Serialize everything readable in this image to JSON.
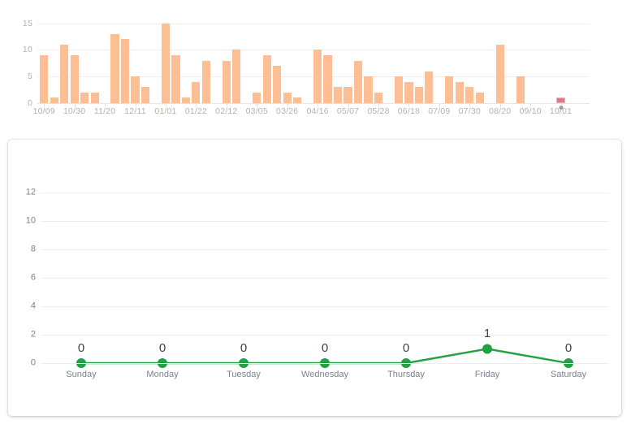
{
  "bar_chart": {
    "y_ticks": [
      0,
      5,
      10,
      15
    ],
    "y_max": 16,
    "x_labels": [
      "10/09",
      "10/30",
      "11/20",
      "12/11",
      "01/01",
      "01/22",
      "02/12",
      "03/05",
      "03/26",
      "04/16",
      "05/07",
      "05/28",
      "06/18",
      "07/09",
      "07/30",
      "08/20",
      "09/10",
      "10/01"
    ],
    "bar_color": "#fcbe92",
    "highlight_color": "#d9798b",
    "marker_color": "#9e9e9e"
  },
  "line_chart": {
    "y_ticks": [
      0,
      2,
      4,
      6,
      8,
      10,
      12
    ],
    "y_max": 13,
    "line_color": "#22a043",
    "point_labels": [
      "0",
      "0",
      "0",
      "0",
      "0",
      "1",
      "0"
    ]
  },
  "chart_data": [
    {
      "type": "bar",
      "title": "",
      "xlabel": "",
      "ylabel": "",
      "ylim": [
        0,
        16
      ],
      "grid": true,
      "legend": "none",
      "categories": [
        "10/09",
        "10/16",
        "10/23",
        "10/30",
        "11/06",
        "11/13",
        "11/20",
        "11/27",
        "12/04",
        "12/11",
        "12/18",
        "12/25",
        "01/01",
        "01/08",
        "01/15",
        "01/22",
        "01/29",
        "02/05",
        "02/12",
        "02/19",
        "02/26",
        "03/05",
        "03/12",
        "03/19",
        "03/26",
        "04/02",
        "04/09",
        "04/16",
        "04/23",
        "04/30",
        "05/07",
        "05/14",
        "05/21",
        "05/28",
        "06/04",
        "06/11",
        "06/18",
        "06/25",
        "07/02",
        "07/09",
        "07/16",
        "07/23",
        "07/30",
        "08/06",
        "08/13",
        "08/20",
        "08/27",
        "09/03",
        "09/10",
        "09/17",
        "09/24",
        "10/01"
      ],
      "values": [
        9,
        1,
        11,
        9,
        2,
        2,
        0,
        13,
        12,
        5,
        3,
        0,
        15,
        9,
        1,
        4,
        8,
        0,
        8,
        10,
        0,
        2,
        9,
        7,
        2,
        1,
        0,
        10,
        9,
        3,
        3,
        8,
        5,
        2,
        0,
        5,
        4,
        3,
        6,
        0,
        5,
        4,
        3,
        2,
        0,
        11,
        0,
        5,
        0,
        0,
        0,
        1
      ],
      "tick_label_every": 3,
      "tick_labels": [
        "10/09",
        "10/30",
        "11/20",
        "12/11",
        "01/01",
        "01/22",
        "02/12",
        "03/05",
        "03/26",
        "04/16",
        "05/07",
        "05/28",
        "06/18",
        "07/09",
        "07/30",
        "08/20",
        "09/10",
        "10/01"
      ],
      "highlight_index": 51,
      "colors": {
        "bars": "#fcbe92",
        "highlight": "#d9798b"
      }
    },
    {
      "type": "line",
      "title": "",
      "xlabel": "",
      "ylabel": "",
      "ylim": [
        0,
        13
      ],
      "grid": true,
      "legend": "none",
      "categories": [
        "Sunday",
        "Monday",
        "Tuesday",
        "Wednesday",
        "Thursday",
        "Friday",
        "Saturday"
      ],
      "values": [
        0,
        0,
        0,
        0,
        0,
        1,
        0
      ],
      "data_labels": [
        "0",
        "0",
        "0",
        "0",
        "0",
        "1",
        "0"
      ],
      "colors": {
        "line": "#22a043",
        "points": "#22a043"
      }
    }
  ]
}
